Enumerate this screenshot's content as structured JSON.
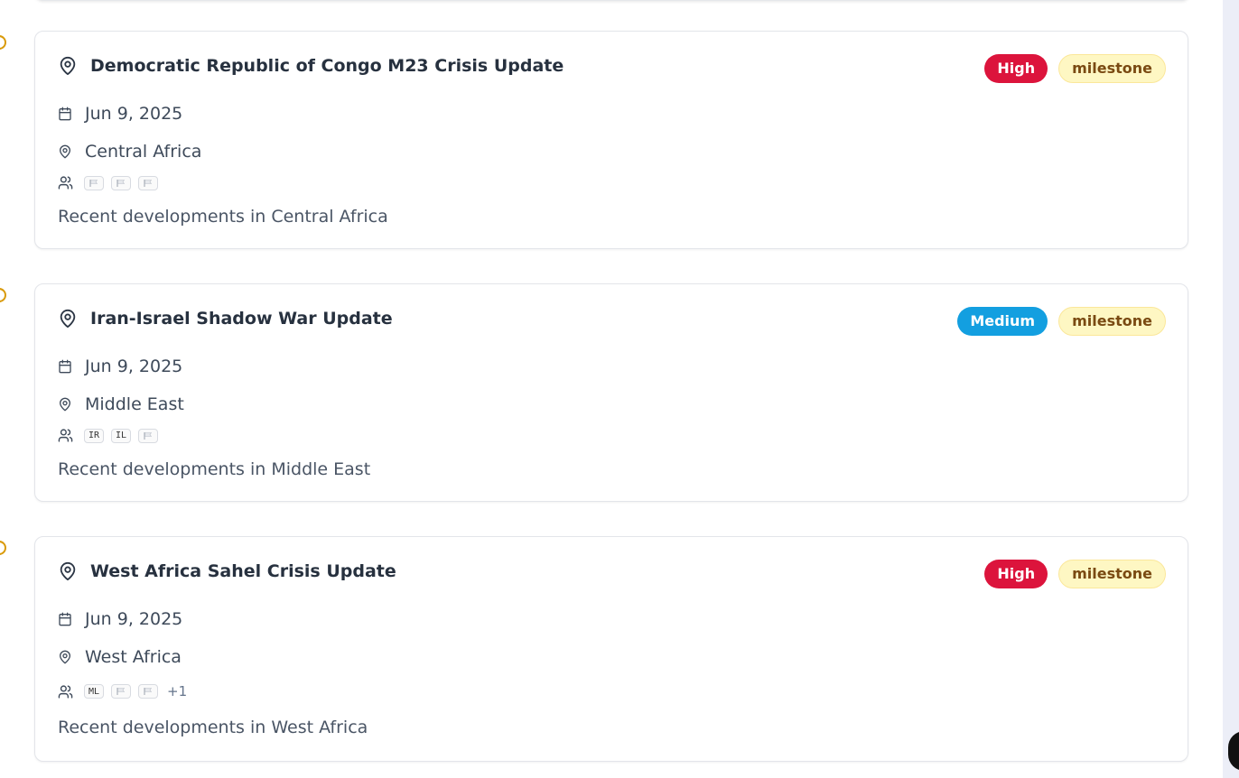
{
  "events": [
    {
      "title": "Democratic Republic of Congo M23 Crisis Update",
      "severity": "High",
      "severity_color": "#dc143c",
      "type": "milestone",
      "date": "Jun 9, 2025",
      "region": "Central Africa",
      "actors": [
        "",
        "",
        ""
      ],
      "more": "",
      "description": "Recent developments in Central Africa"
    },
    {
      "title": "Iran-Israel Shadow War Update",
      "severity": "Medium",
      "severity_color": "#139fe0",
      "type": "milestone",
      "date": "Jun 9, 2025",
      "region": "Middle East",
      "actors": [
        "IR",
        "IL",
        ""
      ],
      "more": "",
      "description": "Recent developments in Middle East"
    },
    {
      "title": "West Africa Sahel Crisis Update",
      "severity": "High",
      "severity_color": "#dc143c",
      "type": "milestone",
      "date": "Jun 9, 2025",
      "region": "West Africa",
      "actors": [
        "ML",
        "",
        ""
      ],
      "more": "+1",
      "description": "Recent developments in West Africa"
    }
  ],
  "icons": {
    "title": "map-pin-icon",
    "date": "calendar-icon",
    "region": "map-pin-icon",
    "actors": "users-icon",
    "flag_placeholder": "flag-icon"
  }
}
